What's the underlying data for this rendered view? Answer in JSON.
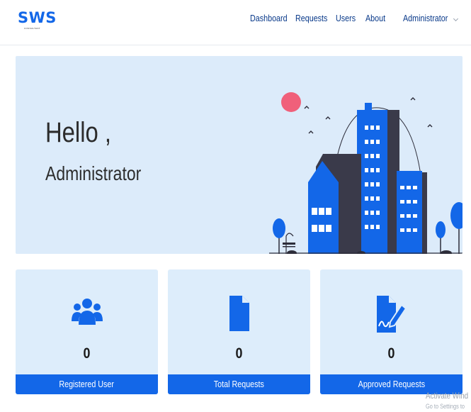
{
  "brand": {
    "name": "SWS",
    "tagline": "CONSULTANT"
  },
  "nav": {
    "items": [
      {
        "label": "Dashboard"
      },
      {
        "label": "Requests"
      },
      {
        "label": "Users"
      },
      {
        "label": "About"
      }
    ],
    "user_menu": {
      "label": "Administrator",
      "icon": "chevron-down-icon"
    }
  },
  "hero": {
    "greeting": "Hello ,",
    "name": "Administrator",
    "illustration": "city-buildings-illustration"
  },
  "cards": [
    {
      "icon": "users-icon",
      "count": "0",
      "label": "Registered User"
    },
    {
      "icon": "document-icon",
      "count": "0",
      "label": "Total Requests"
    },
    {
      "icon": "signed-document-icon",
      "count": "0",
      "label": "Approved Requests"
    }
  ],
  "colors": {
    "primary": "#1367e8",
    "nav_text": "#0a3a8a",
    "hero_bg": "#dcebfa",
    "card_bg": "#ddedfb",
    "accent_sun": "#f0607a"
  },
  "watermark": {
    "line1": "Activate Wind",
    "line2": "Go to Settings to"
  }
}
